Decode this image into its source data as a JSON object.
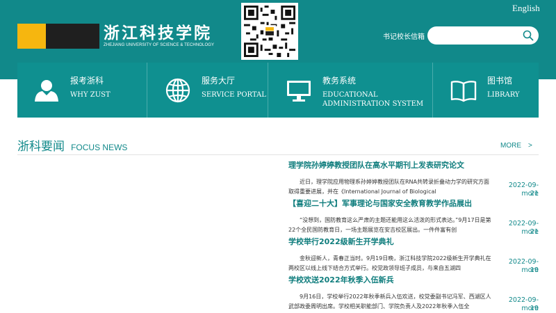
{
  "header": {
    "logo_cn": "浙江科技学院",
    "logo_en": "ZHEJIANG UNIVERSITY OF SCIENCE & TECHNOLOGY",
    "lang_link": "English",
    "mailbox_link": "书记校长信箱",
    "search_placeholder": ""
  },
  "nav": [
    {
      "cn": "报考浙科",
      "en": "WHY ZUST",
      "icon": "user-icon"
    },
    {
      "cn": "服务大厅",
      "en": "SERVICE PORTAL",
      "icon": "globe-icon"
    },
    {
      "cn": "教务系统",
      "en1": "EDUCATIONAL",
      "en2": "ADMINISTRATION SYSTEM",
      "icon": "monitor-icon"
    },
    {
      "cn": "图书馆",
      "en": "LIBRARY",
      "icon": "book-icon"
    }
  ],
  "focus": {
    "title_cn": "浙科要闻",
    "title_en": "FOCUS NEWS",
    "more": "MORE　>"
  },
  "news": [
    {
      "title": "理学院孙婷婷教授团队在高水平期刊上发表研究论文",
      "body": "近日，理学院应用物理系孙婷婷教授团队在RNA共转录折叠动力学的研究方面取得重要进展，并在《International Journal of Biological",
      "date": "2022-09-21",
      "more": "more"
    },
    {
      "title": "【喜迎二十大】军事理论与国家安全教育教学作品展出",
      "body": "“没想到，国防教育这么严肃的主题还能用这么活泼的形式表达。”9月17日是第22个全民国防教育日，一场主题展览在安吉校区展出。一件件富有创",
      "date": "2022-09-21",
      "more": "more"
    },
    {
      "title": "学校举行2022级新生开学典礼",
      "body": "金秋迎新人，青春正当时。9月19日晚，浙江科技学院2022级新生开学典礼在两校区以线上线下结合方式举行。校党政领导班子成员，与来自五湖四",
      "date": "2022-09-19",
      "more": "more"
    },
    {
      "title": "学校欢送2022年秋季入伍新兵",
      "body": "9月16日，学校举行2022年秋季新兵入伍欢送，校党委副书记冯军、西湖区人武部政委周明出席。学校相关职能部门、学院负责人及2022年秋季入伍全",
      "date": "2022-09-19",
      "more": "more"
    }
  ],
  "colors": {
    "brand": "#11898a",
    "nav": "#0f9090",
    "logo_yellow": "#f6b60f"
  }
}
